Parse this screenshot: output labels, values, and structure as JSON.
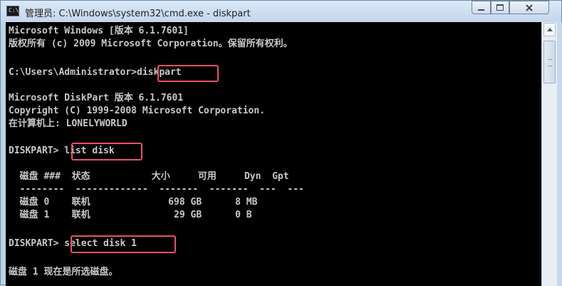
{
  "window": {
    "title": "管理员: C:\\Windows\\system32\\cmd.exe - diskpart",
    "icon_label": "C:\\."
  },
  "console": {
    "lines": [
      "Microsoft Windows [版本 6.1.7601]",
      "版权所有 (c) 2009 Microsoft Corporation。保留所有权利。",
      "",
      "C:\\Users\\Administrator>diskpart",
      "",
      "Microsoft DiskPart 版本 6.1.7601",
      "Copyright (C) 1999-2008 Microsoft Corporation.",
      "在计算机上: LONELYWORLD",
      "",
      "DISKPART> list disk",
      "",
      "  磁盘 ###  状态           大小     可用     Dyn  Gpt",
      "  --------  -------------  -------  -------  ---  ---",
      "  磁盘 0    联机              698 GB      8 MB",
      "  磁盘 1    联机               29 GB      0 B",
      "",
      "DISKPART> select disk 1",
      "",
      "磁盘 1 现在是所选磁盘。"
    ]
  },
  "highlight_color": "#e8506a",
  "icons": {
    "window_icon": "cmd-icon",
    "minimize": "minimize-icon",
    "maximize": "maximize-icon",
    "close": "close-icon",
    "scroll_up": "scroll-up-arrow-icon"
  }
}
